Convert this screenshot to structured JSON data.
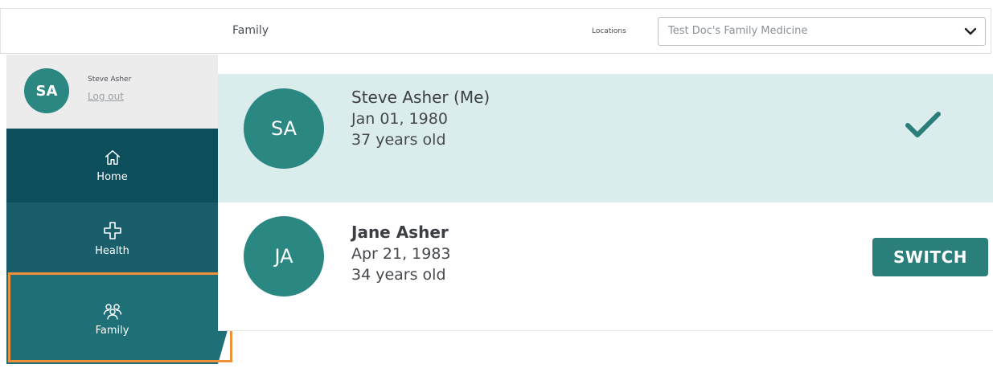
{
  "header": {
    "title": "Family",
    "locations_label": "Locations",
    "location_selected": "Test Doc's Family Medicine"
  },
  "user": {
    "initials": "SA",
    "name": "Steve Asher",
    "logout_label": "Log out"
  },
  "nav": {
    "home": "Home",
    "health": "Health",
    "family": "Family"
  },
  "members": [
    {
      "initials": "SA",
      "name": "Steve Asher",
      "suffix": " (Me)",
      "dob": "Jan 01, 1980",
      "age": "37 years old",
      "status": "current"
    },
    {
      "initials": "JA",
      "name": "Jane Asher",
      "dob": "Apr 21, 1983",
      "age": "34 years old",
      "action_label": "SWITCH"
    }
  ],
  "colors": {
    "accent": "#2a8782",
    "nav_dark": "#0c4e5c",
    "highlight": "#f0913a",
    "current_row_bg": "#dbeced"
  },
  "icons": {
    "home": "home-icon",
    "health": "plus-cross-icon",
    "family": "people-icon",
    "check": "check-icon",
    "dropdown": "chevron-down-icon"
  }
}
